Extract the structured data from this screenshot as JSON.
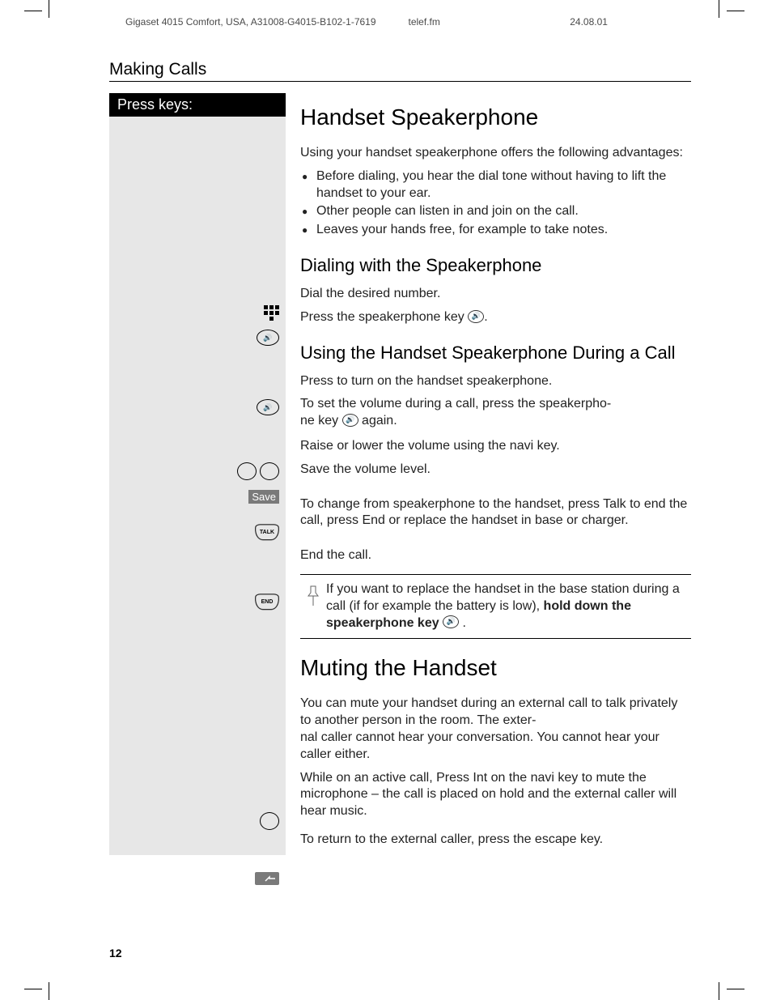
{
  "header": {
    "left": "Gigaset 4015 Comfort, USA, A31008-G4015-B102-1-7619",
    "mid": "telef.fm",
    "right": "24.08.01"
  },
  "section_title": "Making Calls",
  "press_keys_label": "Press keys:",
  "h1_speakerphone": "Handset Speakerphone",
  "intro_speaker": "Using your handset speakerphone offers the following advantages:",
  "advantages": [
    "Before dialing, you hear the dial tone without having to lift the handset to your ear.",
    "Other people can listen in and join on the call.",
    "Leaves your hands free, for example to take notes."
  ],
  "h2_dialing": "Dialing with the Speakerphone",
  "step_dial_number": "Dial the desired number.",
  "step_press_speaker_pre": "Press the speakerphone key ",
  "step_press_speaker_post": ".",
  "h2_during_call": "Using the Handset Speakerphone During a Call",
  "step_turn_on": "Press to turn on the handset speakerphone.",
  "step_set_volume_pre": "To set the volume during a call, press the speakerpho-\nne key ",
  "step_set_volume_post": " again.",
  "step_raise_lower": "Raise or lower the volume using the navi key.",
  "step_save_volume": "Save the volume level.",
  "step_change_talk": "To change from speakerphone to the handset, press Talk to end the call, press End or replace the handset in base or charger.",
  "step_end_call": "End the call.",
  "note_pre": "If you want to replace the handset in the base station during a call (if for example the battery is low), ",
  "note_bold": "hold down the speakerphone key ",
  "note_post": " .",
  "h1_muting": "Muting the Handset",
  "muting_intro": "You can mute your handset during an external call to talk privately to another person in the room. The exter-\nnal caller cannot hear your conversation. You cannot hear your caller either.",
  "step_mute_navi": "While on an active call, Press Int on the navi key to mute the microphone – the call is placed on hold and the external caller will hear music.",
  "step_return_escape": "To return to the external caller, press the escape key.",
  "save_label": "Save",
  "talk_label": "TALK",
  "end_label": "END",
  "page_number": "12"
}
